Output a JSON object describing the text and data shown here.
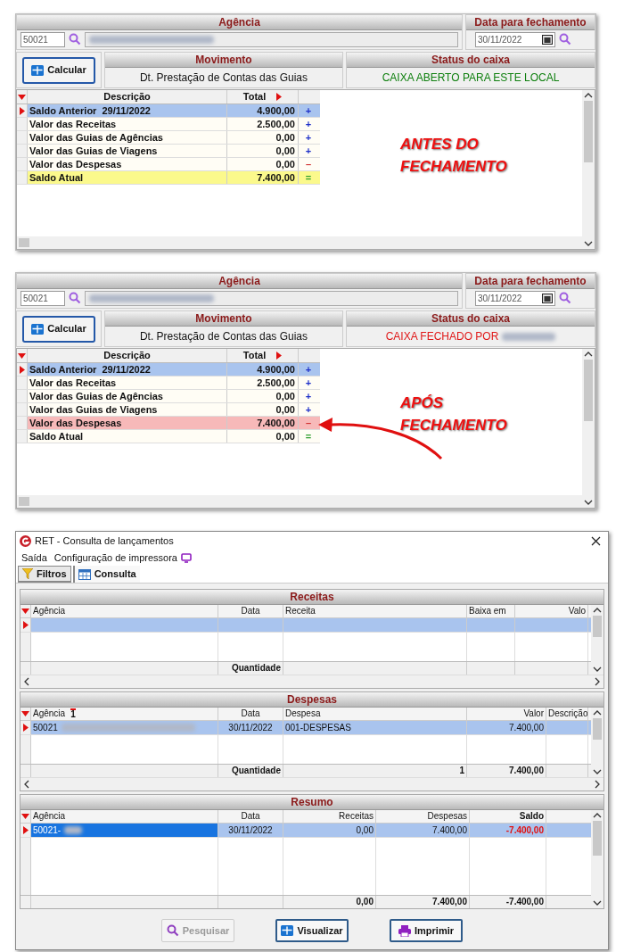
{
  "panels": [
    {
      "agency": {
        "header": "Agência",
        "code": "50021",
        "redacted": true
      },
      "date": {
        "header": "Data para fechamento",
        "value": "30/11/2022"
      },
      "calc_button": "Calcular",
      "movement": {
        "header": "Movimento",
        "value": "Dt. Prestação de Contas das Guias"
      },
      "status": {
        "header": "Status do caixa",
        "value": "CAIXA ABERTO PARA ESTE LOCAL",
        "kind": "open",
        "redacted": false
      },
      "columns": [
        "Descrição",
        "Total"
      ],
      "rows": [
        {
          "description": "Saldo Anterior  29/11/2022",
          "total": "4.900,00",
          "sign": {
            "text": "+",
            "kind": "plus"
          },
          "kind": "selection",
          "selected": true
        },
        {
          "description": "Valor das Receitas",
          "total": "2.500,00",
          "sign": {
            "text": "+",
            "kind": "plus"
          },
          "kind": "plain",
          "selected": false
        },
        {
          "description": "Valor das Guias de Agências",
          "total": "0,00",
          "sign": {
            "text": "+",
            "kind": "plus"
          },
          "kind": "plain",
          "selected": false
        },
        {
          "description": "Valor das Guias de Viagens",
          "total": "0,00",
          "sign": {
            "text": "+",
            "kind": "plus"
          },
          "kind": "plain",
          "selected": false
        },
        {
          "description": "Valor das Despesas",
          "total": "0,00",
          "sign": {
            "text": "–",
            "kind": "minus"
          },
          "kind": "plain",
          "selected": false
        },
        {
          "description": "Saldo Atual",
          "total": "7.400,00",
          "sign": {
            "text": "=",
            "kind": "equals"
          },
          "kind": "total",
          "selected": false
        }
      ],
      "annotation": {
        "lines": [
          "ANTES DO",
          "FECHAMENTO"
        ],
        "arrow": false
      }
    },
    {
      "agency": {
        "header": "Agência",
        "code": "50021",
        "redacted": true
      },
      "date": {
        "header": "Data para fechamento",
        "value": "30/11/2022"
      },
      "calc_button": "Calcular",
      "movement": {
        "header": "Movimento",
        "value": "Dt. Prestação de Contas das Guias"
      },
      "status": {
        "header": "Status do caixa",
        "value": "CAIXA FECHADO POR",
        "kind": "closed",
        "redacted": true
      },
      "columns": [
        "Descrição",
        "Total"
      ],
      "rows": [
        {
          "description": "Saldo Anterior  29/11/2022",
          "total": "4.900,00",
          "sign": {
            "text": "+",
            "kind": "plus"
          },
          "kind": "selection",
          "selected": true
        },
        {
          "description": "Valor das Receitas",
          "total": "2.500,00",
          "sign": {
            "text": "+",
            "kind": "plus"
          },
          "kind": "plain",
          "selected": false
        },
        {
          "description": "Valor das Guias de Agências",
          "total": "0,00",
          "sign": {
            "text": "+",
            "kind": "plus"
          },
          "kind": "plain",
          "selected": false
        },
        {
          "description": "Valor das Guias de Viagens",
          "total": "0,00",
          "sign": {
            "text": "+",
            "kind": "plus"
          },
          "kind": "plain",
          "selected": false
        },
        {
          "description": "Valor das Despesas",
          "total": "7.400,00",
          "sign": {
            "text": "–",
            "kind": "minus"
          },
          "kind": "alert",
          "selected": false
        },
        {
          "description": "Saldo Atual",
          "total": "0,00",
          "sign": {
            "text": "=",
            "kind": "equals"
          },
          "kind": "plain",
          "selected": false
        }
      ],
      "annotation": {
        "lines": [
          "APÓS",
          "FECHAMENTO"
        ],
        "arrow": true
      }
    }
  ],
  "window": {
    "title": "RET - Consulta de lançamentos",
    "menu": [
      {
        "label": "Saída",
        "icon": false
      },
      {
        "label": "Configuração de impressora",
        "icon": true
      }
    ],
    "tabs": [
      {
        "label": "Filtros",
        "kind": "filter",
        "selected": false
      },
      {
        "label": "Consulta",
        "kind": "table",
        "selected": true
      }
    ],
    "grids": [
      {
        "title": "Receitas",
        "columns": [
          {
            "label": "Agência"
          },
          {
            "label": "Data"
          },
          {
            "label": "Receita"
          },
          {
            "label": "Baixa em"
          },
          {
            "label": "Valo"
          }
        ],
        "rows": [
          {
            "selected": true
          }
        ],
        "footer": [
          {
            "kind": "blank"
          },
          {
            "kind": "text",
            "text": "Quantidade"
          },
          {
            "kind": "blank"
          },
          {
            "kind": "blank"
          },
          {
            "kind": "blank"
          }
        ]
      },
      {
        "title": "Despesas",
        "columns": [
          {
            "label": "Agência",
            "sort": "1"
          },
          {
            "label": "Data"
          },
          {
            "label": "Despesa"
          },
          {
            "label": "Valor"
          },
          {
            "label": "Descrição"
          }
        ],
        "rows": [
          {
            "selected": true,
            "focused": false,
            "redacted": true,
            "cells": [
              "50021",
              "30/11/2022",
              "001-DESPESAS",
              "7.400,00"
            ]
          }
        ],
        "footer": [
          {
            "kind": "blank"
          },
          {
            "kind": "text",
            "text": "Quantidade"
          },
          {
            "kind": "text",
            "text": "1"
          },
          {
            "kind": "text",
            "text": "7.400,00"
          },
          {
            "kind": "blank"
          }
        ]
      },
      {
        "title": "Resumo",
        "columns": [
          {
            "label": "Agência"
          },
          {
            "label": "Data"
          },
          {
            "label": "Receitas"
          },
          {
            "label": "Despesas"
          },
          {
            "label": "Saldo",
            "kind": "balance"
          }
        ],
        "rows": [
          {
            "selected": true,
            "focused": true,
            "redacted": true,
            "cells": [
              "50021-",
              "30/11/2022",
              "0,00",
              "7.400,00",
              "-7.400,00"
            ]
          }
        ],
        "footer": [
          {
            "kind": "blank"
          },
          {
            "kind": "blank"
          },
          {
            "kind": "text",
            "text": "0,00"
          },
          {
            "kind": "text",
            "text": "7.400,00"
          },
          {
            "kind": "text",
            "text": "-7.400,00"
          }
        ]
      }
    ],
    "buttons": [
      {
        "label": "Pesquisar",
        "kind": "search",
        "disabled": true
      },
      {
        "label": "Visualizar",
        "kind": "grid",
        "disabled": false
      },
      {
        "label": "Imprimir",
        "kind": "print",
        "disabled": false
      }
    ]
  }
}
